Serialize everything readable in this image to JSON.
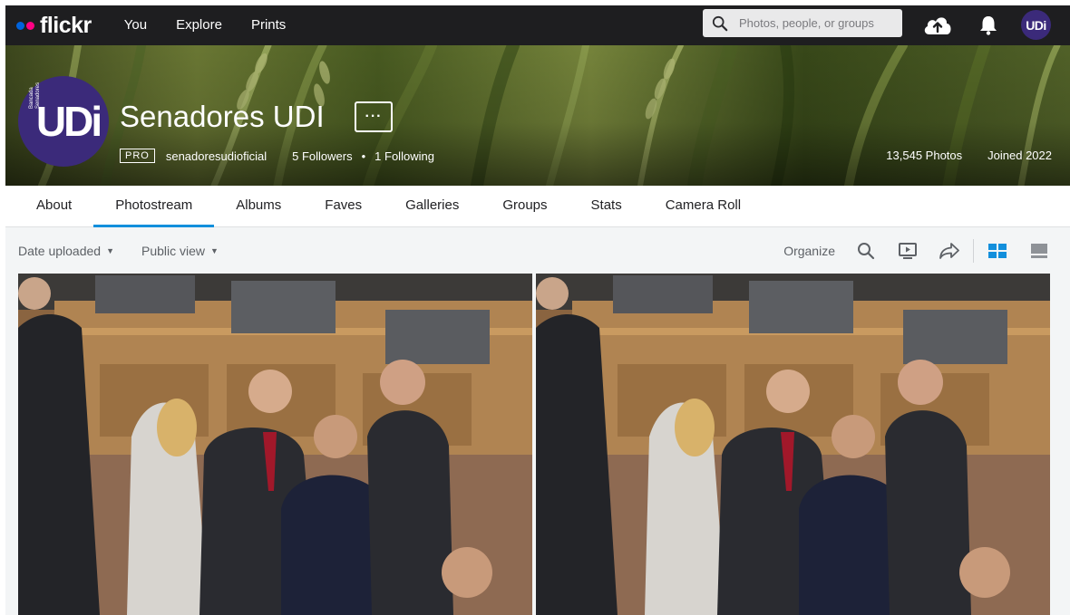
{
  "brand": {
    "name": "flickr",
    "colors": {
      "dot_blue": "#0063dc",
      "dot_pink": "#ff0084",
      "accent": "#128fdc",
      "avatar": "#3b2a7a"
    }
  },
  "topnav": {
    "links": [
      "You",
      "Explore",
      "Prints"
    ],
    "search_placeholder": "Photos, people, or groups",
    "icons": [
      "search-icon",
      "upload-cloud-icon",
      "notification-bell-icon"
    ],
    "avatar_text": "UDi"
  },
  "profile": {
    "avatar_text": "UDi",
    "avatar_side_text": [
      "Bancada",
      "Senadores"
    ],
    "name": "Senadores UDI",
    "more_label": "···",
    "pro_label": "PRO",
    "username": "senadoresudioficial",
    "followers": "5 Followers",
    "separator": "•",
    "following": "1 Following",
    "photos_count": "13,545 Photos",
    "joined": "Joined 2022"
  },
  "tabs": [
    {
      "label": "About",
      "active": false
    },
    {
      "label": "Photostream",
      "active": true
    },
    {
      "label": "Albums",
      "active": false
    },
    {
      "label": "Faves",
      "active": false
    },
    {
      "label": "Galleries",
      "active": false
    },
    {
      "label": "Groups",
      "active": false
    },
    {
      "label": "Stats",
      "active": false
    },
    {
      "label": "Camera Roll",
      "active": false
    }
  ],
  "toolbar": {
    "sort_label": "Date uploaded",
    "view_label": "Public view",
    "organize_label": "Organize",
    "icons": [
      "search-icon",
      "slideshow-icon",
      "share-icon",
      "grid-view-icon",
      "detail-view-icon"
    ]
  },
  "photos": [
    {
      "name": "photo-senate-meeting-1"
    },
    {
      "name": "photo-senate-meeting-2"
    }
  ]
}
